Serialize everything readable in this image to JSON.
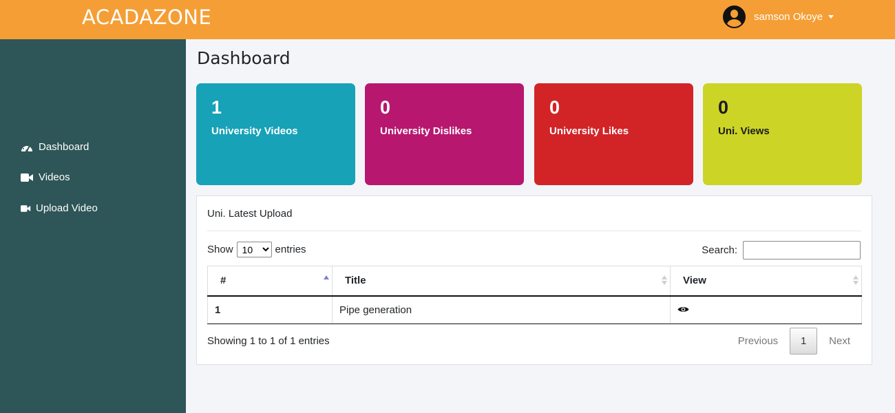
{
  "header": {
    "brand": "ACADAZONE",
    "username": "samson Okoye"
  },
  "sidebar": {
    "items": [
      {
        "label": "Dashboard",
        "icon": "speedometer-icon"
      },
      {
        "label": "Videos",
        "icon": "video-camera-icon"
      },
      {
        "label": "Upload Video",
        "icon": "video-camera-icon"
      }
    ]
  },
  "main": {
    "title": "Dashboard",
    "cards": [
      {
        "value": "1",
        "label": "University Videos",
        "color": "#17a2b8"
      },
      {
        "value": "0",
        "label": "University Dislikes",
        "color": "#b8176f"
      },
      {
        "value": "0",
        "label": "University Likes",
        "color": "#d22427"
      },
      {
        "value": "0",
        "label": "Uni. Views",
        "color": "#ccd426"
      }
    ],
    "panel": {
      "title": "Uni. Latest Upload",
      "show_label": "Show",
      "entries_value": "10",
      "entries_label": "entries",
      "search_label": "Search:",
      "search_value": "",
      "columns": [
        "#",
        "Title",
        "View"
      ],
      "rows": [
        {
          "num": "1",
          "title": "Pipe generation",
          "view_icon": "eye-icon"
        }
      ],
      "info": "Showing 1 to 1 of 1 entries",
      "pager": {
        "previous": "Previous",
        "current": "1",
        "next": "Next"
      }
    }
  },
  "colors": {
    "topbar": "#f59e35",
    "sidebar": "#2e5557"
  }
}
